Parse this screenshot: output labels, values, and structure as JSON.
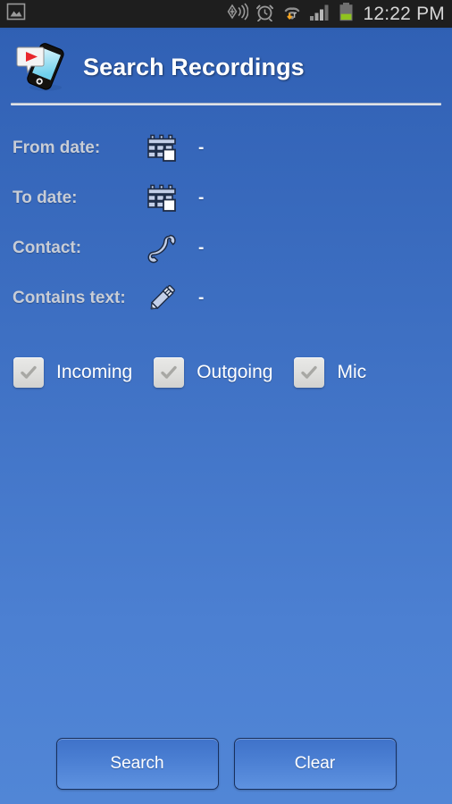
{
  "status_bar": {
    "icons_left": [
      "gallery-image-icon"
    ],
    "icons_right": [
      "nfc-beam-icon",
      "alarm-clock-icon",
      "wifi-download-icon",
      "cellular-signal-icon",
      "battery-icon"
    ],
    "clock": "12:22 PM"
  },
  "header": {
    "logo": "phone-recording-app-icon",
    "title": "Search Recordings"
  },
  "form": {
    "rows": [
      {
        "label": "From date:",
        "icon": "calendar-icon",
        "value": "-"
      },
      {
        "label": "To date:",
        "icon": "calendar-icon",
        "value": "-"
      },
      {
        "label": "Contact:",
        "icon": "phone-handset-icon",
        "value": "-"
      },
      {
        "label": "Contains text:",
        "icon": "pencil-icon",
        "value": "-"
      }
    ]
  },
  "filters": {
    "checkboxes": [
      {
        "label": "Incoming",
        "checked": true
      },
      {
        "label": "Outgoing",
        "checked": true
      },
      {
        "label": "Mic",
        "checked": true
      }
    ]
  },
  "actions": {
    "search_label": "Search",
    "clear_label": "Clear"
  },
  "colors": {
    "background_top": "#2f5fb3",
    "background_bottom": "#5186d6",
    "status_bar": "#1e1e1e",
    "title_text": "#ffffff",
    "label_text": "#c8cdd6",
    "button_border": "#18305e",
    "battery_green": "#8fc31f",
    "download_arrow": "#f5a623"
  }
}
